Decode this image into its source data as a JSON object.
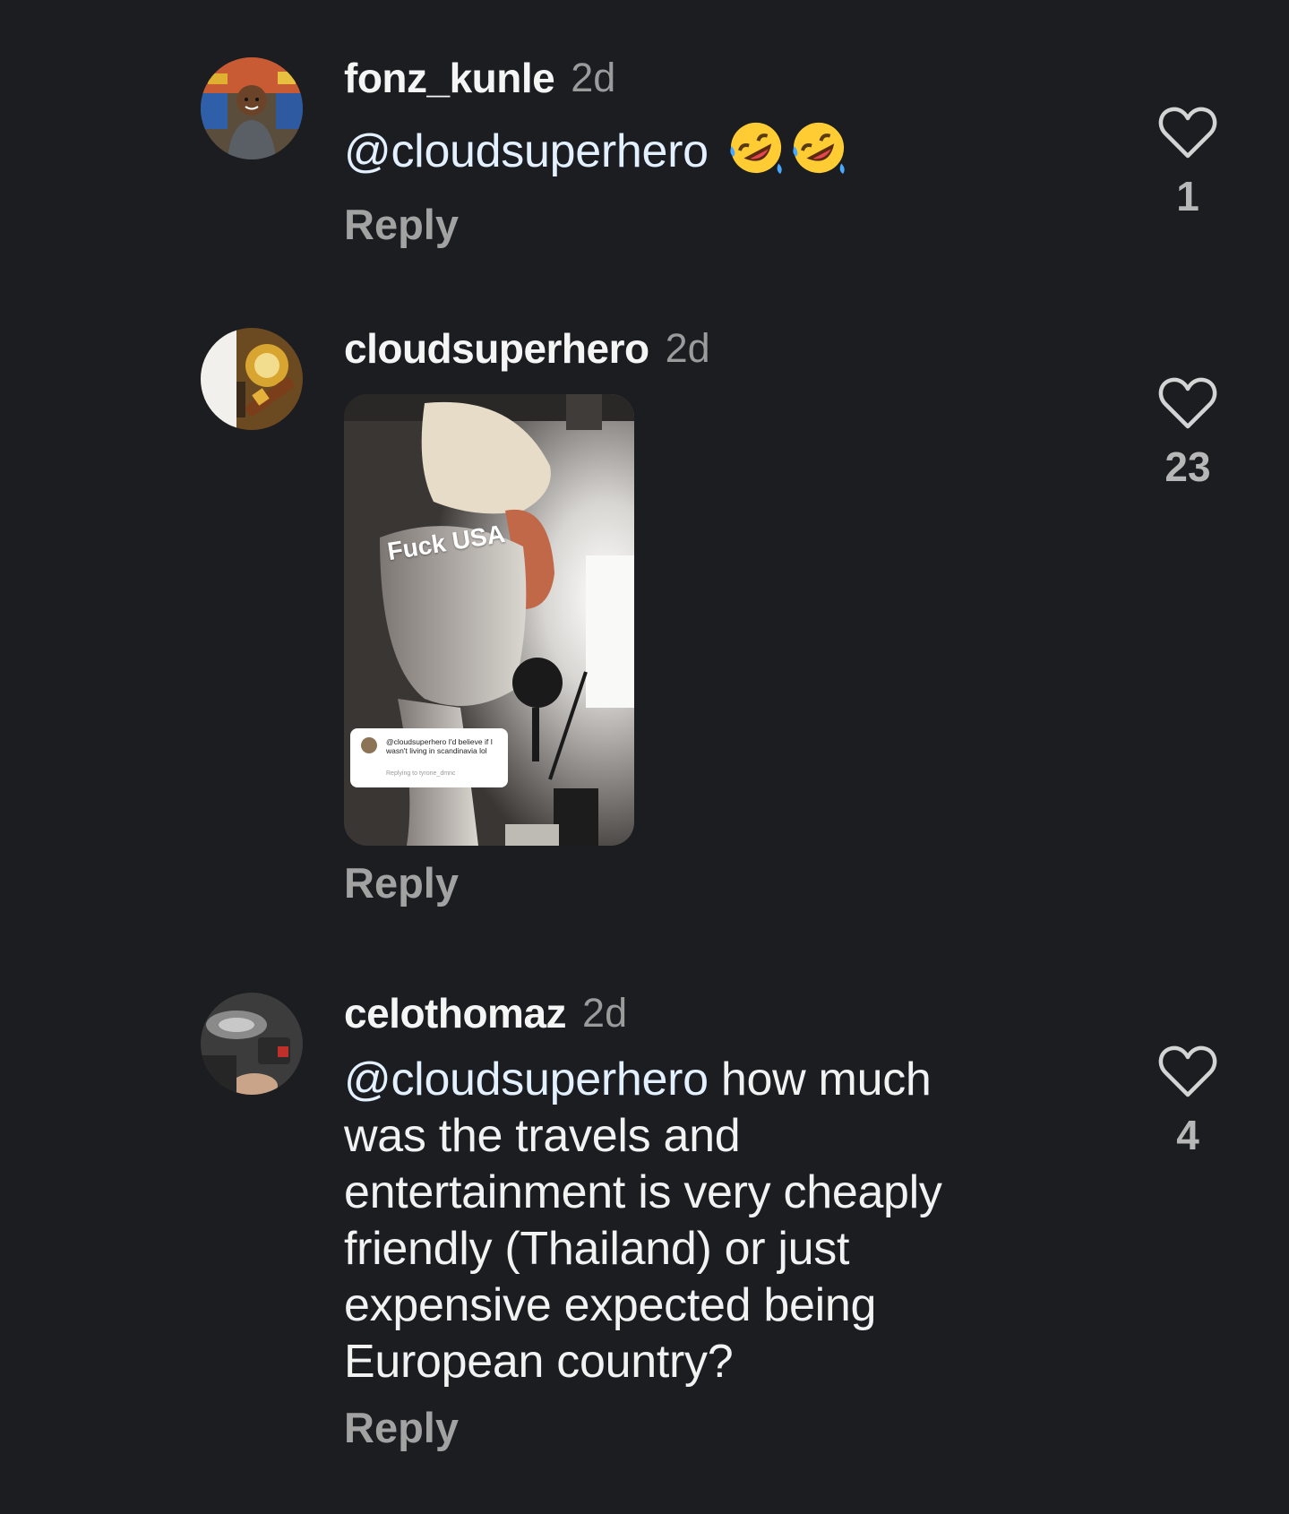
{
  "comments": [
    {
      "username": "fonz_kunle",
      "time": "2d",
      "mention": "@cloudsuperhero",
      "text": "",
      "emoji": [
        "rolling-on-floor-laughing-emoji",
        "rolling-on-floor-laughing-emoji"
      ],
      "reply_label": "Reply",
      "likes": "1",
      "avatar": "boy-in-store-photo"
    },
    {
      "username": "cloudsuperhero",
      "time": "2d",
      "media": {
        "sticker_text": "Fuck USA",
        "reply_card_text": "@cloudsuperhero I'd believe if I wasn't living in scandinavia lol",
        "reply_card_sub": "Replying to tyrone_dmnc"
      },
      "reply_label": "Reply",
      "likes": "23",
      "avatar": "drink-and-cigar-photo"
    },
    {
      "username": "celothomaz",
      "time": "2d",
      "mention": "@cloudsuperhero",
      "text_lines": [
        " how much",
        "was the travels and",
        "entertainment is very cheaply",
        "friendly (Thailand) or just",
        "expensive expected being",
        "European country?"
      ],
      "reply_label": "Reply",
      "likes": "4",
      "avatar": "car-interior-photo"
    }
  ],
  "colors": {
    "background": "#1b1d21",
    "username": "#f5f5f5",
    "timestamp": "#9b9b9b",
    "mention": "#e3f0ff",
    "reply": "#a2a2a2"
  }
}
